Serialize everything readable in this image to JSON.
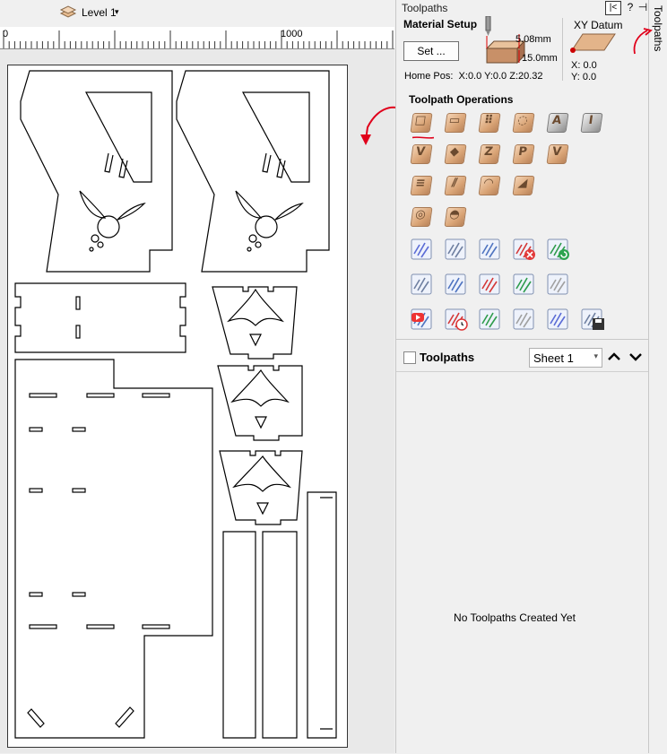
{
  "toolbar": {
    "level_label": "Level 1",
    "level_caret": "▾"
  },
  "ruler": {
    "label_start": "0",
    "label_1000": "1000"
  },
  "panel": {
    "title": "Toolpaths",
    "collapse_icon": "|<",
    "help_icon": "?",
    "pin_icon": "⊣",
    "material_setup": {
      "title": "Material Setup",
      "set_button": "Set ...",
      "z_top": "5.08mm",
      "thickness": "15.0mm",
      "home_pos_label": "Home Pos:",
      "home_pos_value": "X:0.0 Y:0.0 Z:20.32"
    },
    "xy_datum": {
      "title": "XY Datum",
      "x": "X: 0.0",
      "y": "Y: 0.0"
    },
    "operations": {
      "title": "Toolpath Operations",
      "row1": [
        "profile-icon",
        "pocket-icon",
        "drilling-icon",
        "inlay-icon",
        "vcarve-text-icon",
        "texture-icon"
      ],
      "row2": [
        "vcarve-icon",
        "prism-icon",
        "fluting-icon",
        "quick-engrave-icon",
        "moulding-icon"
      ],
      "row3": [
        "fluting-lines-icon",
        "chamfer-icon",
        "roughing-3d-icon",
        "finishing-3d-icon"
      ],
      "row4": [
        "profile-3d-icon",
        "dome-icon"
      ],
      "glyphs": {
        "row1": [
          "□",
          "▭",
          "⠿",
          "◌",
          "A",
          "I"
        ],
        "row2": [
          "V",
          "◆",
          "Z",
          "P",
          "V"
        ],
        "row3": [
          "≡",
          "⫽",
          "◠",
          "◢"
        ],
        "row4": [
          "◎",
          "◓"
        ]
      },
      "utility_rows": [
        [
          "tool-database-icon",
          "edit-toolpath-icon",
          "merge-toolpaths-icon",
          "delete-toolpath-icon",
          "recalculate-icon"
        ],
        [
          "toolpath-template-open-icon",
          "save-template-icon",
          "template-export-icon",
          "gadget-icon",
          "transform-toolpath-icon"
        ],
        [
          "preview-toolpath-icon",
          "time-estimate-icon",
          "summary-icon",
          "job-sheet-icon",
          "document-icon",
          "save-toolpath-icon"
        ]
      ]
    },
    "toolpaths_list": {
      "label": "Toolpaths",
      "sheet_select": "Sheet 1",
      "up": "⌃",
      "down": "⌄",
      "empty_message": "No Toolpaths Created Yet"
    }
  },
  "side_tab": {
    "label": "Toolpaths"
  },
  "colors": {
    "accent_tile": "#d9a476",
    "annotation_red": "#e0001b",
    "panel_bg": "#f0f0f0"
  }
}
